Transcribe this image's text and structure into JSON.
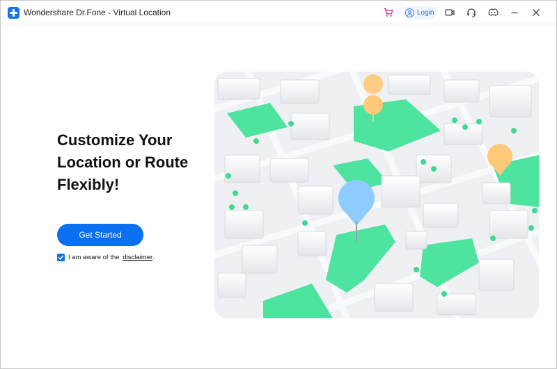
{
  "window": {
    "title": "Wondershare Dr.Fone - Virtual Location"
  },
  "toolbar": {
    "login_label": "Login",
    "icons": [
      "cart-icon",
      "user-icon",
      "camera-icon",
      "headset-icon",
      "discord-icon",
      "minimize-icon",
      "close-icon"
    ]
  },
  "hero": {
    "title_line1": "Customize Your",
    "title_line2": "Location or Route",
    "title_line3": "Flexibly!"
  },
  "cta": {
    "label": "Get Started"
  },
  "consent": {
    "text": "I am aware of the",
    "link": "disclaimer",
    "suffix": ".",
    "checked": true
  },
  "colors": {
    "accent": "#0a6ff0",
    "park": "#4fe3a0",
    "pin_orange": "#ffc97a",
    "pin_blue": "#8ecbff"
  }
}
